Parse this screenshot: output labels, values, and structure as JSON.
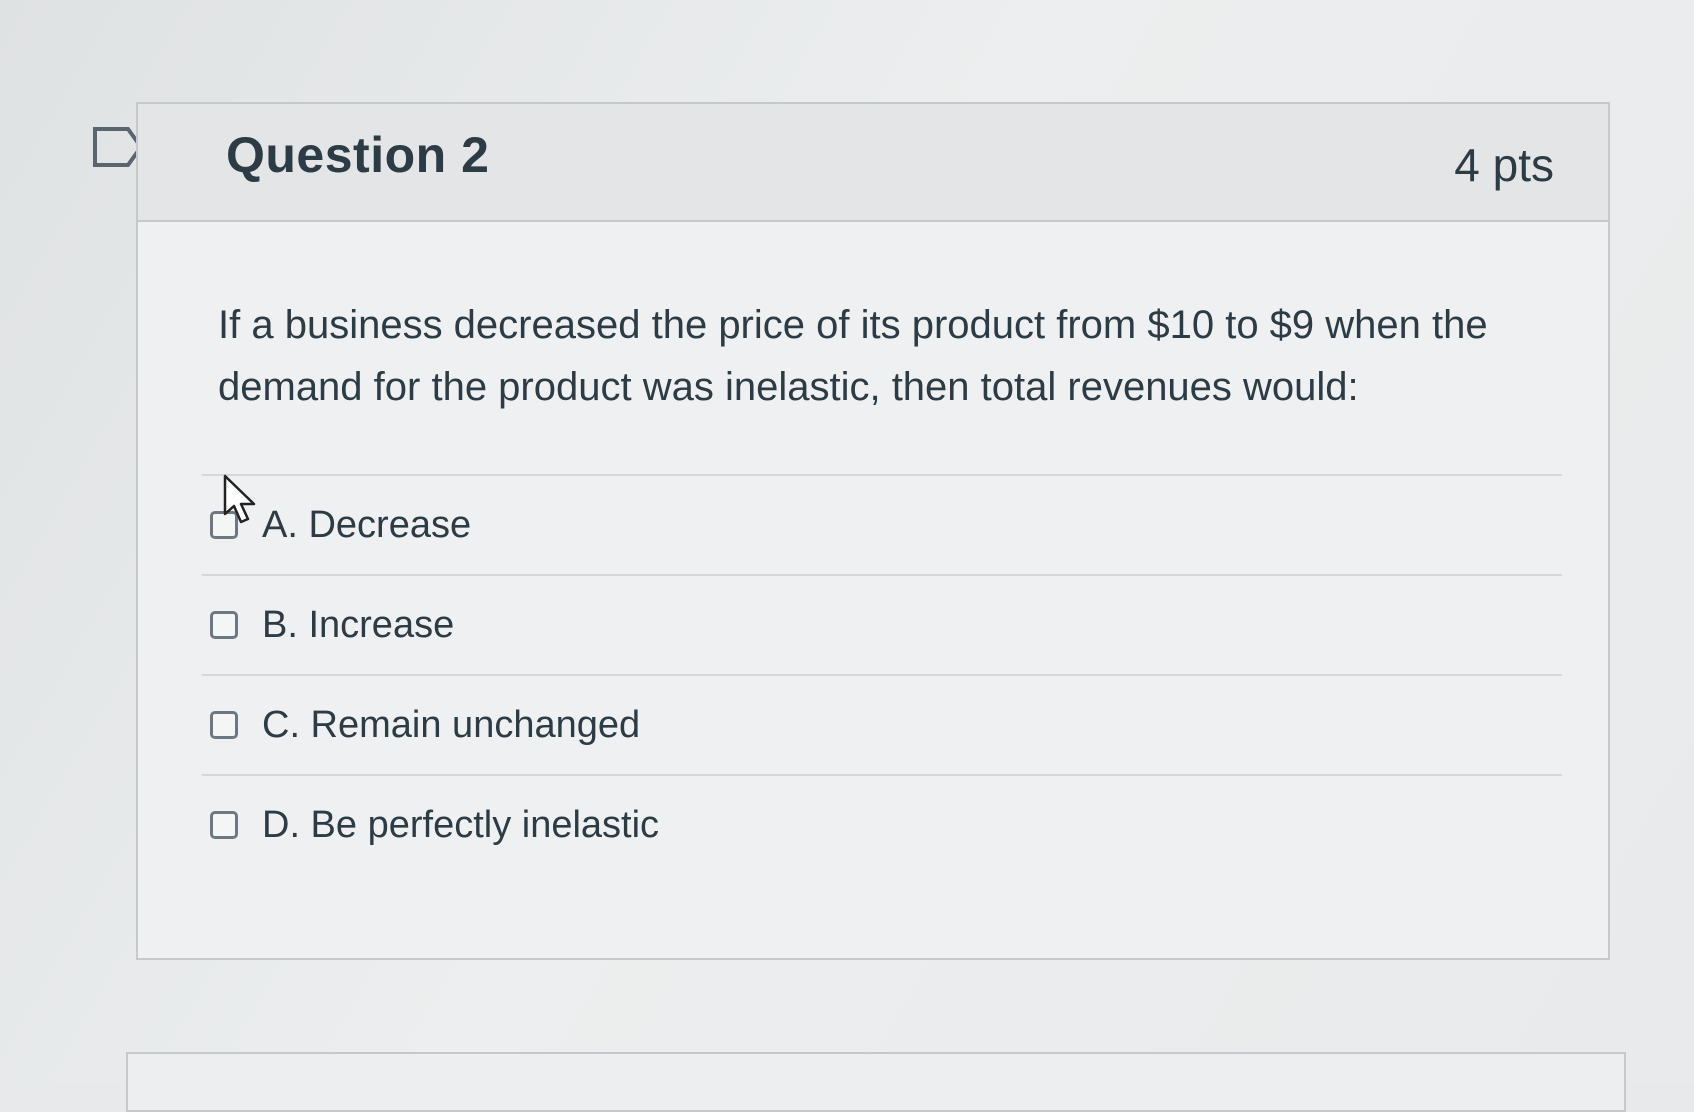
{
  "question": {
    "title": "Question 2",
    "points": "4 pts",
    "text": "If a business decreased the price of its product from $10 to $9 when the demand for the product was inelastic, then total revenues would:",
    "answers": [
      {
        "label": "A. Decrease",
        "checked": false
      },
      {
        "label": "B. Increase",
        "checked": false
      },
      {
        "label": "C. Remain unchanged",
        "checked": false
      },
      {
        "label": "D. Be perfectly inelastic",
        "checked": false
      }
    ]
  },
  "icons": {
    "flag": "flag-question-icon",
    "cursor": "mouse-pointer-icon"
  },
  "colors": {
    "text": "#2d3b45",
    "border": "#c5c9cc",
    "header_bg": "#e3e5e6",
    "checkbox_border": "#6d7883"
  }
}
